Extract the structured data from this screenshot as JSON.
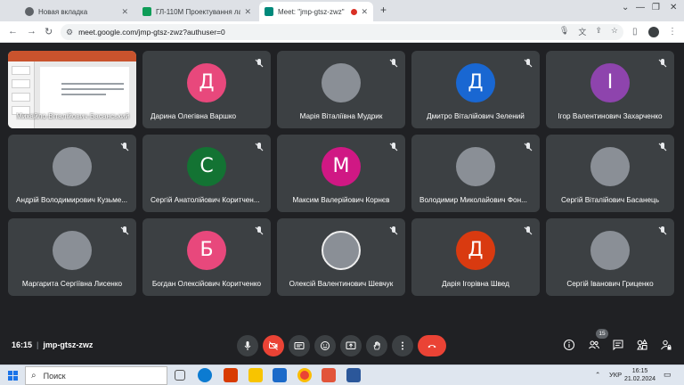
{
  "browser": {
    "tabs": [
      {
        "label": "Новая вкладка",
        "favicon_color": "#5f6368",
        "active": false
      },
      {
        "label": "ГЛ-110М Проектування ланцю",
        "favicon_color": "#0f9d58",
        "active": false
      },
      {
        "label": "Meet: \"jmp-gtsz-zwz\"",
        "favicon_color": "#00897b",
        "active": true
      }
    ],
    "new_tab_label": "+",
    "url": "meet.google.com/jmp-gtsz-zwz?authuser=0"
  },
  "meet": {
    "presenter_name": "Михайло Віталійович Басанський",
    "participants": [
      {
        "name": "Дарина Олегівна Варшко",
        "initial": "Д",
        "avatar_color": "#e8487c"
      },
      {
        "name": "Марія Віталіївна Мудрик",
        "initial": "",
        "avatar_color": "#8a8f96",
        "photo": "ph1"
      },
      {
        "name": "Дмитро Віталійович Зелений",
        "initial": "Д",
        "avatar_color": "#1967d2"
      },
      {
        "name": "Ігор Валентинович Захарченко",
        "initial": "І",
        "avatar_color": "#8e44ad"
      },
      {
        "name": "Андрій Володимирович Кузьме...",
        "initial": "",
        "avatar_color": "#8a8f96",
        "photo": "ph2"
      },
      {
        "name": "Сергій Анатолійович Коритчен...",
        "initial": "С",
        "avatar_color": "#137333"
      },
      {
        "name": "Максим Валерійович Корнєв",
        "initial": "М",
        "avatar_color": "#d01884"
      },
      {
        "name": "Володимир Миколайович Фон...",
        "initial": "",
        "avatar_color": "#8a8f96",
        "photo": "ph3"
      },
      {
        "name": "Сергій Віталійович Басанець",
        "initial": "",
        "avatar_color": "#8a8f96",
        "photo": "ph4"
      },
      {
        "name": "Маргарита Сергіївна Лисенко",
        "initial": "",
        "avatar_color": "#8a8f96",
        "photo": "ph5"
      },
      {
        "name": "Богдан Олексійович Коритченко",
        "initial": "Б",
        "avatar_color": "#e8487c"
      },
      {
        "name": "Олексій Валентинович Шевчук",
        "initial": "",
        "avatar_color": "#111111",
        "photo": "ph6"
      },
      {
        "name": "Дарія Ігорівна Швед",
        "initial": "Д",
        "avatar_color": "#d93a10"
      },
      {
        "name": "Сергій Іванович Гриценко",
        "initial": "",
        "avatar_color": "#8a8f96",
        "photo": "ph7"
      }
    ],
    "time": "16:15",
    "meeting_code": "jmp-gtsz-zwz",
    "participants_count": "15"
  },
  "taskbar": {
    "search_placeholder": "Поиск",
    "language": "УКР",
    "clock_time": "16:15",
    "clock_date": "21.02.2024"
  }
}
